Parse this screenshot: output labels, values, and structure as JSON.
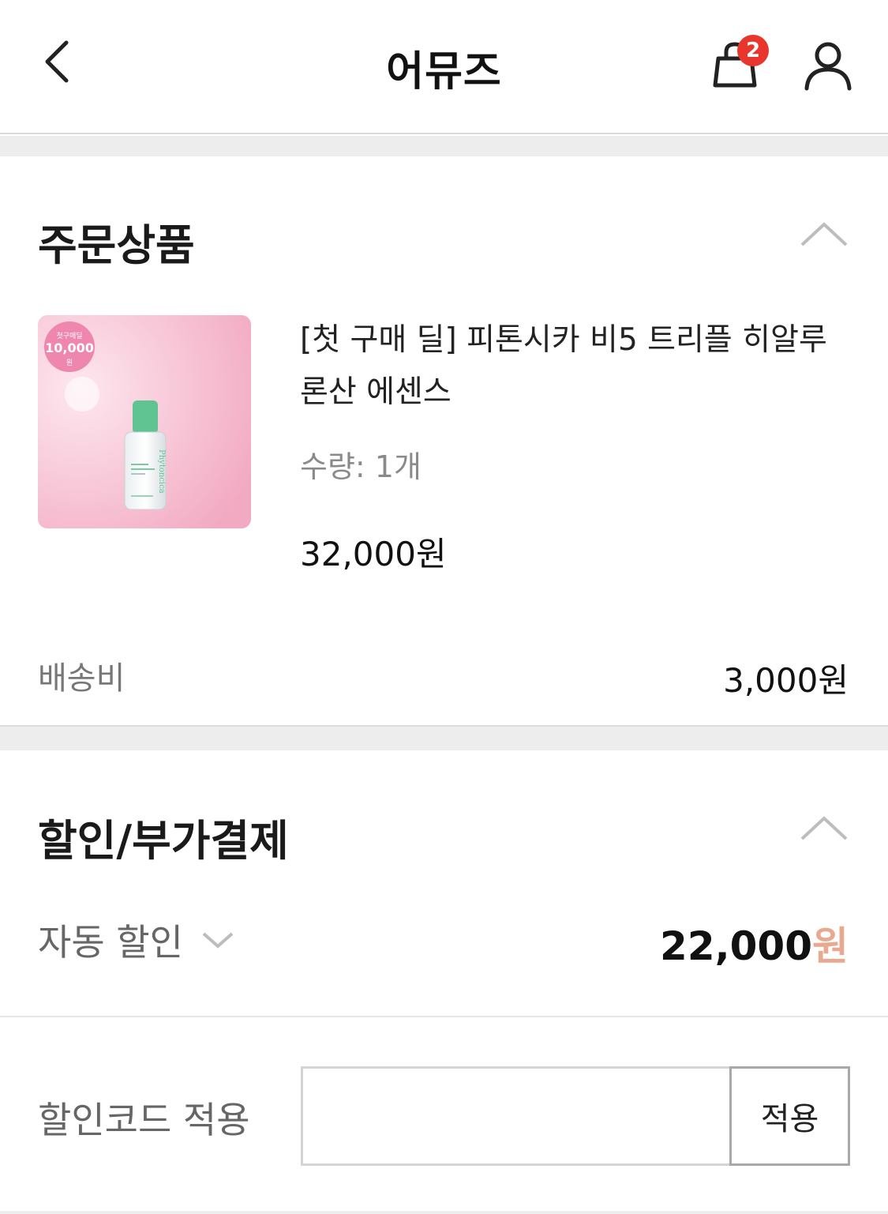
{
  "header": {
    "title": "어뮤즈",
    "cart_count": "2"
  },
  "order_section": {
    "title": "주문상품",
    "product": {
      "name": "[첫 구매 딜] 피톤시카 비5 트리플 히알루론산 에센스",
      "quantity": "수량: 1개",
      "price": "32,000원",
      "thumb_badge_top": "첫구매딜",
      "thumb_badge_amount": "10,000",
      "thumb_badge_unit": "원",
      "bottle_brand": "Phytoncica"
    },
    "shipping_label": "배송비",
    "shipping_value": "3,000원"
  },
  "discount_section": {
    "title": "할인/부가결제",
    "auto_discount_label": "자동 할인",
    "auto_discount_amount": "22,000",
    "auto_discount_unit": "원",
    "code_label": "할인코드 적용",
    "code_value": "",
    "code_placeholder": "",
    "apply_label": "적용"
  },
  "colors": {
    "badge": "#e8362c",
    "accent_unit": "#e7a98f",
    "thumb_bg": "#f7c6d6",
    "bottle_cap": "#5fc392"
  }
}
